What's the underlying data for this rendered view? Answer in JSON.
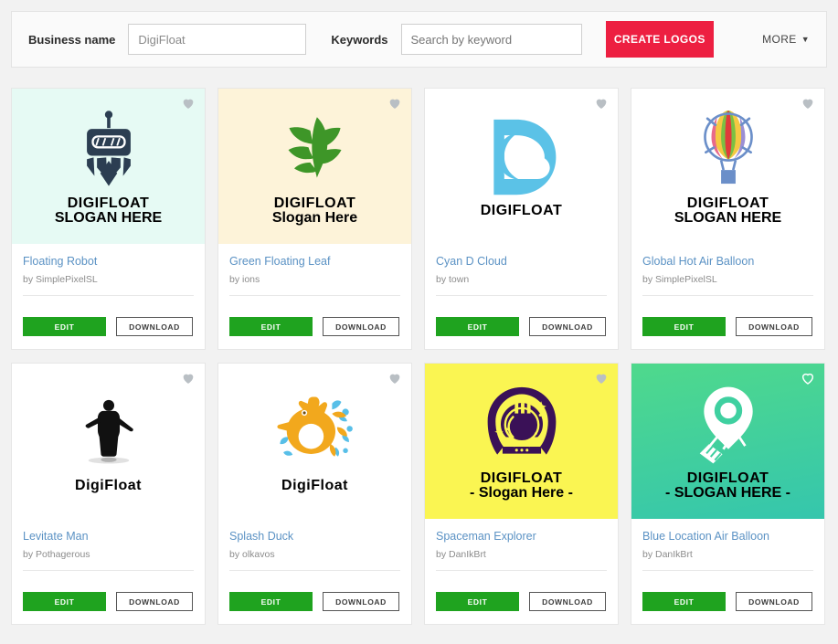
{
  "search": {
    "business_label": "Business name",
    "business_value": "DigiFloat",
    "keywords_label": "Keywords",
    "keywords_placeholder": "Search by keyword",
    "create_label": "CREATE LOGOS",
    "more_label": "MORE",
    "create_color": "#ed1f41"
  },
  "buttons": {
    "edit": "EDIT",
    "download": "DOWNLOAD",
    "edit_color": "#1fa31f"
  },
  "cards": [
    {
      "name": "Floating Robot",
      "author": "by SimplePixelSL",
      "bg": "#e6faf4",
      "icon": "robot-logo-icon",
      "favorited": false,
      "wordmark": "DIGIFLOAT",
      "slogan": "SLOGAN HERE",
      "mark_color": "#2c3e52",
      "wordmark_size": "20px",
      "slogan_size": "16px",
      "wordmark_style": "sans-bold",
      "slogan_style": "sans-bold"
    },
    {
      "name": "Green Floating Leaf",
      "author": "by ions",
      "bg": "#fdf3d9",
      "icon": "leaf-logo-icon",
      "favorited": false,
      "wordmark": "DIGIFLOAT",
      "slogan": "Slogan Here",
      "mark_color": "#3e9628",
      "wordmark_size": "20px",
      "slogan_size": "17px",
      "wordmark_style": "sans-bold",
      "slogan_style": "script"
    },
    {
      "name": "Cyan D Cloud",
      "author": "by town",
      "bg": "#ffffff",
      "icon": "cloud-d-logo-icon",
      "favorited": false,
      "wordmark": "DIGIFLOAT",
      "slogan": "",
      "mark_color": "#5bc2e7",
      "wordmark_size": "20px",
      "slogan_size": "0px",
      "wordmark_style": "sans-bold",
      "slogan_style": "sans-bold"
    },
    {
      "name": "Global Hot Air Balloon",
      "author": "by SimplePixelSL",
      "bg": "#ffffff",
      "icon": "hot-air-balloon-logo-icon",
      "favorited": false,
      "wordmark": "DIGIFLOAT",
      "slogan": "SLOGAN HERE",
      "mark_color": "#6b8fc9",
      "wordmark_size": "19px",
      "slogan_size": "15px",
      "wordmark_style": "mono-bold",
      "slogan_style": "mono-bold"
    },
    {
      "name": "Levitate Man",
      "author": "by Pothagerous",
      "bg": "#ffffff",
      "icon": "levitating-man-logo-icon",
      "favorited": false,
      "wordmark": "DigiFloat",
      "slogan": "",
      "mark_color": "#111111",
      "wordmark_size": "24px",
      "slogan_size": "0px",
      "wordmark_style": "serif",
      "slogan_style": "serif"
    },
    {
      "name": "Splash Duck",
      "author": "by olkavos",
      "bg": "#ffffff",
      "icon": "duck-splash-logo-icon",
      "favorited": false,
      "wordmark": "DigiFloat",
      "slogan": "",
      "mark_color": "#58c3ea",
      "wordmark_size": "22px",
      "slogan_size": "0px",
      "wordmark_style": "sans-bold",
      "slogan_style": "sans-bold"
    },
    {
      "name": "Spaceman Explorer",
      "author": "by DanIkBrt",
      "bg": "#faf552",
      "icon": "astronaut-helmet-logo-icon",
      "favorited": false,
      "wordmark": "DIGIFLOAT",
      "slogan": "- Slogan Here -",
      "mark_color": "#3a1157",
      "wordmark_size": "19px",
      "slogan_size": "16px",
      "wordmark_style": "sans-bold",
      "slogan_style": "rounded"
    },
    {
      "name": "Blue Location Air Balloon",
      "author": "by DanIkBrt",
      "bg": "linear-gradient(170deg,#4fd98c 0%,#35c6ad 100%)",
      "icon": "location-pin-balloon-logo-icon",
      "favorited": true,
      "wordmark": "DIGIFLOAT",
      "slogan": "- SLOGAN HERE -",
      "mark_color": "#ffffff",
      "wordmark_size": "20px",
      "slogan_size": "14px",
      "wordmark_style": "sans-bold",
      "slogan_style": "sans-bold"
    }
  ]
}
